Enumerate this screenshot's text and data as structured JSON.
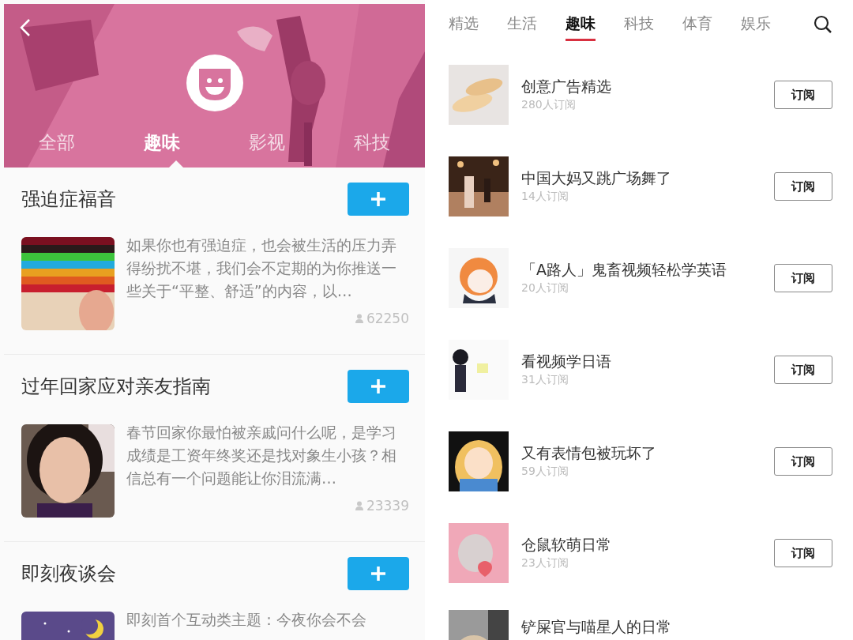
{
  "left": {
    "tabs": [
      {
        "label": "全部",
        "selected": false
      },
      {
        "label": "趣味",
        "selected": true
      },
      {
        "label": "影视",
        "selected": false
      },
      {
        "label": "科技",
        "selected": false
      }
    ],
    "topics": [
      {
        "title": "强迫症福音",
        "description": "如果你也有强迫症，也会被生活的压力弄得纷扰不堪，我们会不定期的为你推送一些关于“平整、舒适”的内容，以…",
        "count": "62250"
      },
      {
        "title": "过年回家应对亲友指南",
        "description": "春节回家你最怕被亲戚问什么呢，是学习成绩是工资年终奖还是找对象生小孩？相信总有一个问题能让你泪流满…",
        "count": "23339"
      },
      {
        "title": "即刻夜谈会",
        "description": "即刻首个互动类主题：今夜你会不会"
      }
    ]
  },
  "right": {
    "tabs": [
      {
        "label": "精选",
        "selected": false
      },
      {
        "label": "生活",
        "selected": false
      },
      {
        "label": "趣味",
        "selected": true
      },
      {
        "label": "科技",
        "selected": false
      },
      {
        "label": "体育",
        "selected": false
      },
      {
        "label": "娱乐",
        "selected": false
      }
    ],
    "channels": [
      {
        "name": "创意广告精选",
        "subscribers": "280人订阅",
        "button": "订阅"
      },
      {
        "name": "中国大妈又跳广场舞了",
        "subscribers": "14人订阅",
        "button": "订阅"
      },
      {
        "name": "「A路人」鬼畜视频轻松学英语",
        "subscribers": "20人订阅",
        "button": "订阅"
      },
      {
        "name": "看视频学日语",
        "subscribers": "31人订阅",
        "button": "订阅"
      },
      {
        "name": "又有表情包被玩坏了",
        "subscribers": "59人订阅",
        "button": "订阅"
      },
      {
        "name": "仓鼠软萌日常",
        "subscribers": "23人订阅",
        "button": "订阅"
      },
      {
        "name": "铲屎官与喵星人的日常"
      }
    ]
  }
}
